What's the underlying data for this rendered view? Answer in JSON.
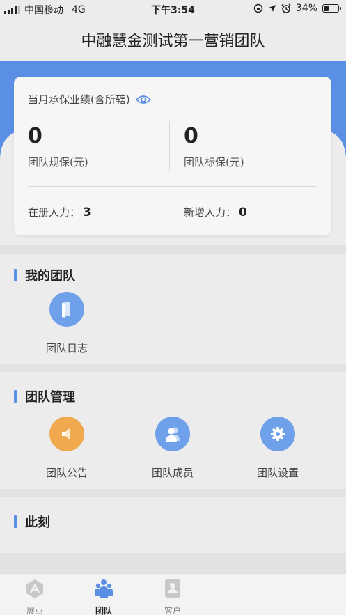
{
  "status_bar": {
    "carrier": "中国移动",
    "network": "4G",
    "time": "下午3:54",
    "battery": "34%"
  },
  "header": {
    "title": "中融慧金测试第一营销团队"
  },
  "performance": {
    "title": "当月承保业绩(含所辖)",
    "team_scale_value": "0",
    "team_scale_label": "团队规保(元)",
    "team_standard_value": "0",
    "team_standard_label": "团队标保(元)",
    "registered_label": "在册人力：",
    "registered_value": "3",
    "new_label": "新增人力：",
    "new_value": "0"
  },
  "my_team": {
    "title": "我的团队",
    "items": [
      {
        "label": "团队日志",
        "icon": "book-icon",
        "color": "#6fa0ea"
      }
    ]
  },
  "team_management": {
    "title": "团队管理",
    "items": [
      {
        "label": "团队公告",
        "icon": "speaker-icon",
        "color": "#f0a94c"
      },
      {
        "label": "团队成员",
        "icon": "user-icon",
        "color": "#6fa0ea"
      },
      {
        "label": "团队设置",
        "icon": "gear-icon",
        "color": "#6fa0ea"
      }
    ]
  },
  "moment": {
    "title": "此刻"
  },
  "tabbar": {
    "tabs": [
      {
        "label": "展业",
        "icon": "explore-icon",
        "active": false
      },
      {
        "label": "团队",
        "icon": "team-icon",
        "active": true
      },
      {
        "label": "客户",
        "icon": "customer-icon",
        "active": false
      }
    ]
  },
  "colors": {
    "accent": "#5b8fe6",
    "orange": "#f0a94c",
    "background": "#ececec"
  }
}
